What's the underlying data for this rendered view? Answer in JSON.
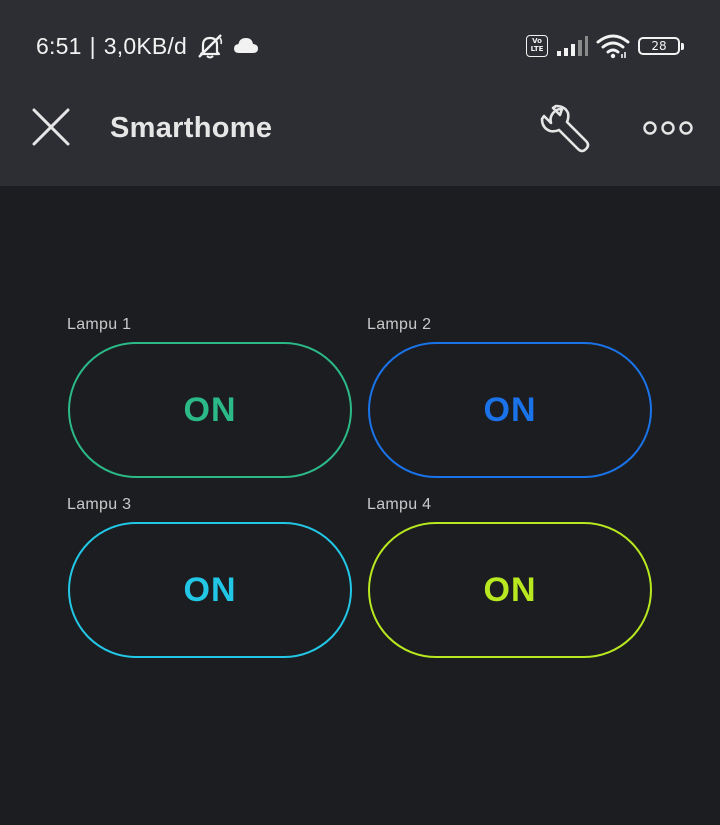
{
  "status_bar": {
    "time": "6:51",
    "separator": "|",
    "data_rate": "3,0KB/d",
    "volte_label": "Vo\nLTE",
    "battery_level": "28",
    "icons": [
      "bell-off-icon",
      "cloud-icon",
      "volte-icon",
      "signal-icon",
      "wifi-icon",
      "battery-icon"
    ]
  },
  "header": {
    "title": "Smarthome",
    "icons": [
      "close-icon",
      "wrench-icon",
      "more-icon"
    ]
  },
  "switches": [
    {
      "label": "Lampu 1",
      "state": "ON",
      "color": "#2bb987"
    },
    {
      "label": "Lampu 2",
      "state": "ON",
      "color": "#1a73e8"
    },
    {
      "label": "Lampu 3",
      "state": "ON",
      "color": "#22c7e6"
    },
    {
      "label": "Lampu 4",
      "state": "ON",
      "color": "#b8e81f"
    }
  ],
  "colors": {
    "background": "#1c1d21",
    "header_background": "#2d2e33",
    "title_text": "#e6e6e6"
  }
}
